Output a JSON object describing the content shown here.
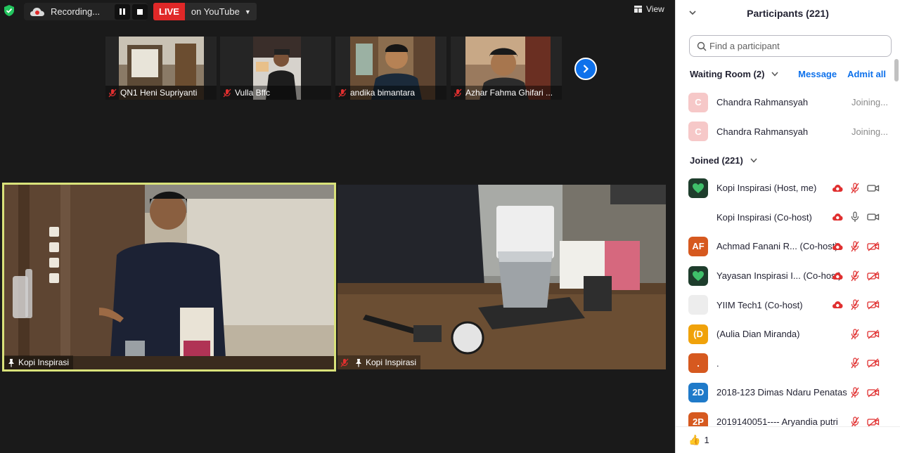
{
  "meeting": {
    "recording_label": "Recording...",
    "live_label": "LIVE",
    "live_target": "on YouTube",
    "view_label": "View",
    "thumbnails": [
      {
        "name": "QN1 Heni Supriyanti"
      },
      {
        "name": "Vulla Bffc"
      },
      {
        "name": "andika bimantara"
      },
      {
        "name": "Azhar Fahma Ghifari ..."
      }
    ],
    "videos": [
      {
        "name": "Kopi Inspirasi"
      },
      {
        "name": "Kopi Inspirasi"
      }
    ]
  },
  "panel": {
    "title": "Participants (221)",
    "search_placeholder": "Find a participant",
    "waiting_room_label": "Waiting Room (2)",
    "message_label": "Message",
    "admit_all_label": "Admit all",
    "joined_label": "Joined (221)",
    "waiting": [
      {
        "initials": "C",
        "name": "Chandra Rahmansyah",
        "status": "Joining..."
      },
      {
        "initials": "C",
        "name": "Chandra Rahmansyah",
        "status": "Joining..."
      }
    ],
    "joined": [
      {
        "initials": "",
        "name": "Kopi Inspirasi (Host, me)",
        "avatar": "logo"
      },
      {
        "initials": "",
        "name": "Kopi Inspirasi (Co-host)",
        "avatar": "none"
      },
      {
        "initials": "AF",
        "name": "Achmad Fanani R... (Co-host)",
        "avatar": "orange"
      },
      {
        "initials": "",
        "name": "Yayasan Inspirasi I... (Co-host)",
        "avatar": "logo"
      },
      {
        "initials": "",
        "name": "YIIM Tech1 (Co-host)",
        "avatar": "grey"
      },
      {
        "initials": "(D",
        "name": "(Aulia Dian Miranda)",
        "avatar": "amber"
      },
      {
        "initials": ".",
        "name": ".",
        "avatar": "orange2"
      },
      {
        "initials": "2D",
        "name": "2018-123 Dimas Ndaru Penatas",
        "avatar": "blue"
      },
      {
        "initials": "2P",
        "name": "2019140051---- Aryandia putri",
        "avatar": "orange2"
      }
    ],
    "reaction_count": "1"
  },
  "colors": {
    "accent": "#0e71eb",
    "live_red": "#e02828",
    "muted_red": "#e02f2f",
    "active_speaker": "#d9e27a"
  }
}
